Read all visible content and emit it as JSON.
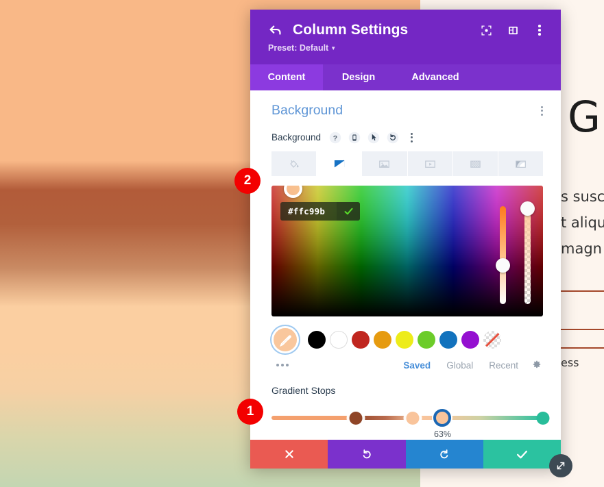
{
  "header": {
    "title": "Column Settings",
    "preset_label": "Preset: Default",
    "back_icon": "back-arrow-icon",
    "icons": [
      "focus-target-icon",
      "layout-columns-icon",
      "kebab-menu-icon"
    ]
  },
  "tabs": [
    {
      "label": "Content",
      "active": true
    },
    {
      "label": "Design",
      "active": false
    },
    {
      "label": "Advanced",
      "active": false
    }
  ],
  "section": {
    "title": "Background",
    "kebab_icon": "kebab-menu-icon"
  },
  "field": {
    "label": "Background",
    "icons": [
      "help-icon",
      "responsive-mobile-icon",
      "hover-cursor-icon",
      "reset-undo-icon",
      "kebab-menu-icon"
    ]
  },
  "background_types": [
    {
      "name": "color-fill",
      "icon": "paint-bucket-icon",
      "active": false
    },
    {
      "name": "gradient",
      "icon": "gradient-icon",
      "active": true
    },
    {
      "name": "image",
      "icon": "image-icon",
      "active": false
    },
    {
      "name": "video",
      "icon": "video-icon",
      "active": false
    },
    {
      "name": "pattern",
      "icon": "pattern-icon",
      "active": false
    },
    {
      "name": "mask",
      "icon": "mask-icon",
      "active": false
    }
  ],
  "color_picker": {
    "hex_value": "#ffc99b",
    "hex_placeholder": "#ffffff",
    "confirm_icon": "checkmark-icon",
    "hue_slider_name": "hue-slider",
    "alpha_slider_name": "alpha-slider"
  },
  "swatches": {
    "eyedropper": {
      "icon": "eyedropper-icon",
      "color": "#f9c79d"
    },
    "colors": [
      "#000000",
      "#ffffff",
      "#c0261f",
      "#e69b10",
      "#edec1a",
      "#6ccc2a",
      "#1272bd",
      "#9410d0"
    ],
    "transparent_label": "transparent",
    "more_icon": "more-dots-icon"
  },
  "palette_tabs": [
    {
      "label": "Saved",
      "active": true
    },
    {
      "label": "Global",
      "active": false
    },
    {
      "label": "Recent",
      "active": false
    }
  ],
  "palette_settings_icon": "gear-icon",
  "gradient": {
    "label": "Gradient Stops",
    "selected_percent": "63%",
    "stops": [
      {
        "position": 31,
        "color": "#8f4527",
        "selected": false
      },
      {
        "position": 52,
        "color": "#f9c49b",
        "selected": false
      },
      {
        "position": 63,
        "color": "#f9c49b",
        "selected": true
      },
      {
        "position": 100,
        "color": "#28bd9a",
        "selected": false
      }
    ]
  },
  "footer": {
    "cancel": {
      "icon": "close-x-icon",
      "color": "#ea5a52"
    },
    "undo": {
      "icon": "undo-icon",
      "color": "#7b31cc"
    },
    "redo": {
      "icon": "redo-icon",
      "color": "#2585d0"
    },
    "save": {
      "icon": "checkmark-icon",
      "color": "#2bc2a0"
    }
  },
  "badges": [
    {
      "number": "1"
    },
    {
      "number": "2"
    }
  ],
  "page_behind": {
    "big_letter": "G",
    "paragraph_lines": [
      "s susc",
      "t aliqu",
      "magn"
    ],
    "word": "ess"
  },
  "resize_handle_icon": "resize-diagonal-icon"
}
